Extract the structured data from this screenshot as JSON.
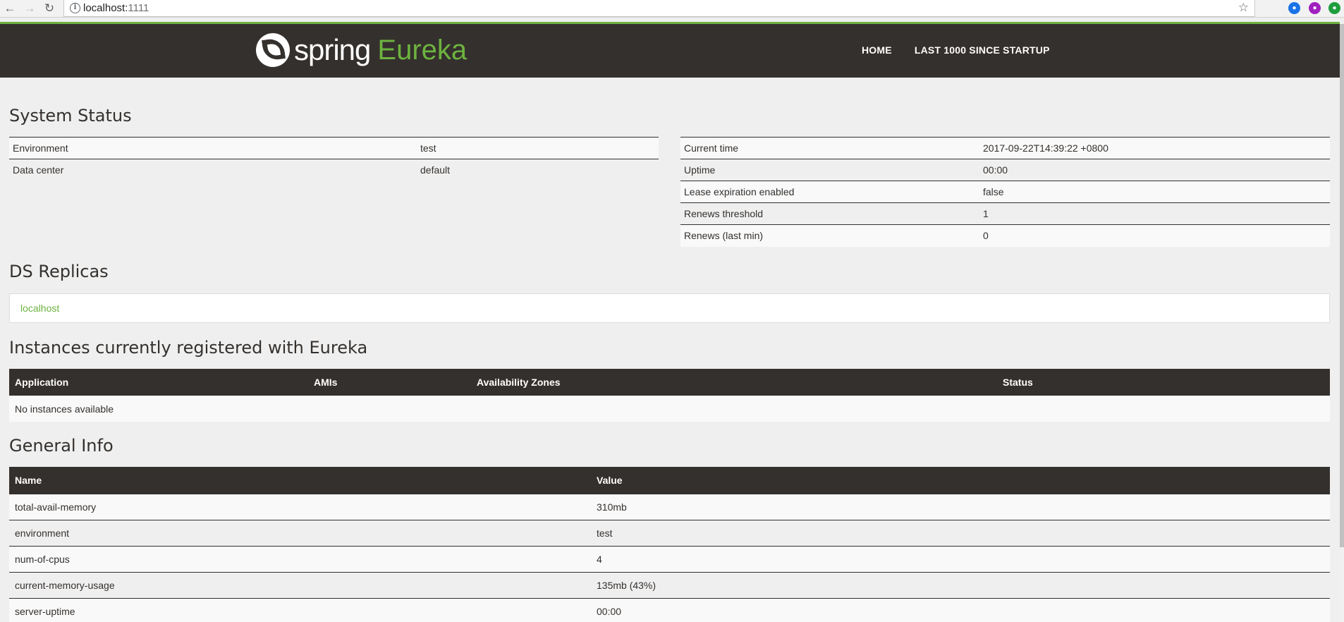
{
  "browser": {
    "url_host": "localhost:",
    "url_port": "1111"
  },
  "header": {
    "logo_spring": "spring",
    "logo_eureka": "Eureka",
    "nav": [
      "HOME",
      "LAST 1000 SINCE STARTUP"
    ]
  },
  "system_status": {
    "title": "System Status",
    "left": [
      {
        "key": "Environment",
        "value": "test"
      },
      {
        "key": "Data center",
        "value": "default"
      }
    ],
    "right": [
      {
        "key": "Current time",
        "value": "2017-09-22T14:39:22 +0800"
      },
      {
        "key": "Uptime",
        "value": "00:00"
      },
      {
        "key": "Lease expiration enabled",
        "value": "false"
      },
      {
        "key": "Renews threshold",
        "value": "1"
      },
      {
        "key": "Renews (last min)",
        "value": "0"
      }
    ]
  },
  "ds_replicas": {
    "title": "DS Replicas",
    "items": [
      "localhost"
    ]
  },
  "instances": {
    "title": "Instances currently registered with Eureka",
    "columns": [
      "Application",
      "AMIs",
      "Availability Zones",
      "Status"
    ],
    "empty_text": "No instances available"
  },
  "general_info": {
    "title": "General Info",
    "columns": [
      "Name",
      "Value"
    ],
    "rows": [
      {
        "name": "total-avail-memory",
        "value": "310mb"
      },
      {
        "name": "environment",
        "value": "test"
      },
      {
        "name": "num-of-cpus",
        "value": "4"
      },
      {
        "name": "current-memory-usage",
        "value": "135mb (43%)"
      },
      {
        "name": "server-uptime",
        "value": "00:00"
      }
    ]
  },
  "colors": {
    "brand_green": "#6db33f",
    "dark": "#34302d"
  }
}
